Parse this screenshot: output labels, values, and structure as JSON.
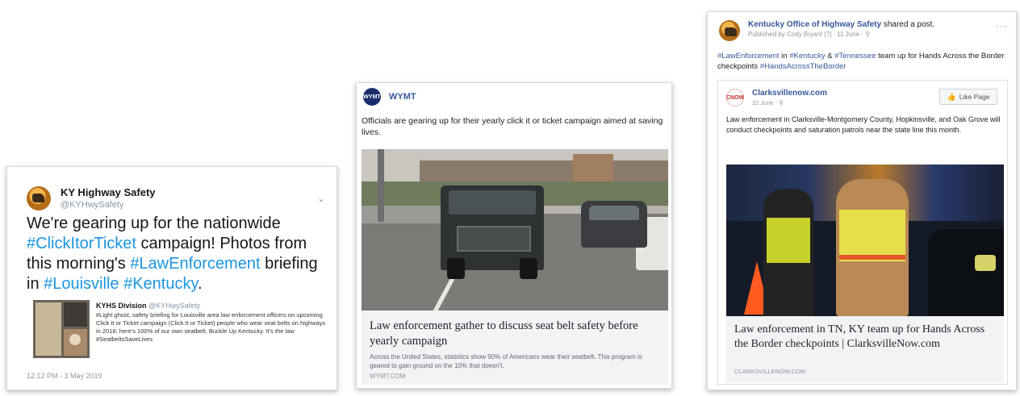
{
  "tweet": {
    "account_name": "KY Highway Safety",
    "handle": "@KYHwySafety",
    "text_pre": "We're gearing up for the nationwide ",
    "hashtag1": "#ClickItorTicket",
    "text_mid": " campaign!  Photos from this morning's ",
    "hashtag2": "#LawEnforcement",
    "text_mid2": " briefing in ",
    "hashtag3": "#Louisville",
    "text_space": " ",
    "hashtag4": "#Kentucky",
    "text_end": ".",
    "quoted": {
      "author": "KYHS Division",
      "handle": "@KYHwySafety",
      "text": "#Light ghost, safety briefing for Louisville area law enforcement officers on upcoming Click It or Ticket campaign (Click It or Ticket) people who wear seat belts on highways in 2018; here's 100% of our own seatbelt, Buckle Up Kentucky. It's the law #SeatbeltsSaveLives"
    },
    "timestamp": "12:12 PM - 3 May 2019"
  },
  "wymt_post": {
    "page_name": "WYMT",
    "logo_text": "WYMT",
    "text": "Officials are gearing up for their yearly click it or ticket campaign aimed at saving lives.",
    "link_title": "Law enforcement gather to discuss seat belt safety before yearly campaign",
    "link_desc": "Across the United States, statistics show 90% of Americans wear their seatbelt. This program is geared to gain ground on the 10% that doesn't.",
    "link_domain": "WYMT.COM"
  },
  "kyo_post": {
    "page_name": "Kentucky Office of Highway Safety",
    "action": " shared a post.",
    "subline": "Published by Cody Bryant [?] · 11 June · ⚲",
    "more": "···",
    "tag1": "#LawEnforcement",
    "txt1": " in ",
    "tag2": "#Kentucky",
    "txt2": " & ",
    "tag3": "#Tennessee",
    "txt3": " team up for Hands Across the Border checkpoints ",
    "tag4": "#HandsAcrossTheBorder",
    "shared": {
      "page_name": "Clarksvillenow.com",
      "logo_text": "CNOW",
      "subline": "22 June · ⚲",
      "like_label": "Like Page",
      "text": "Law enforcement in Clarksville-Montgomery County, Hopkinsville, and Oak Grove will conduct checkpoints and saturation patrols near the state line this month.",
      "link_title": "Law enforcement in TN, KY team up for Hands Across the Border checkpoints | ClarksvilleNow.com",
      "link_domain": "CLARKSVILLENOW.COM"
    }
  }
}
